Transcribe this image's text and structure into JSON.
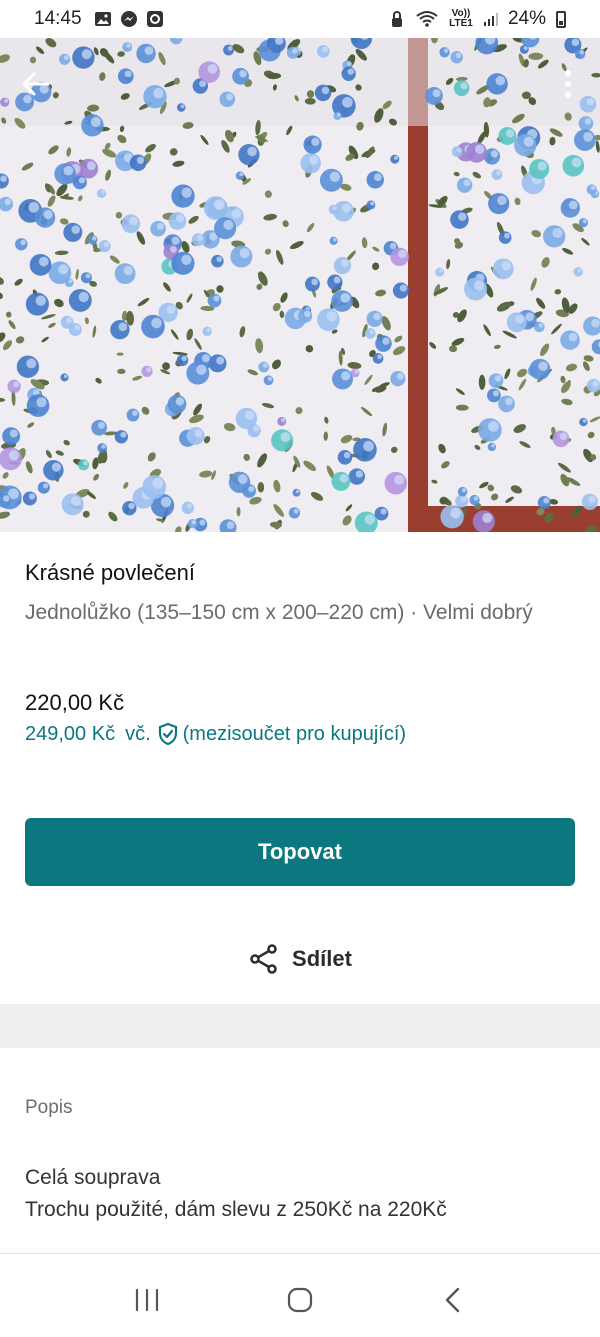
{
  "status_bar": {
    "time": "14:45",
    "network": "Vo)) LTE1",
    "battery": "24%",
    "icons": [
      "gallery-icon",
      "messenger-icon",
      "app-notification-icon",
      "lock-alarm-icon",
      "wifi-icon",
      "signal-icon",
      "battery-icon"
    ]
  },
  "hero": {
    "image_description_icon": "floral-bedding-photo",
    "back_icon": "arrow-left-icon",
    "menu_icon": "more-vertical-icon"
  },
  "listing": {
    "title": "Krásné povlečení",
    "subtitle": "Jednolůžko (135–150 cm x 200–220 cm) · Velmi dobrý",
    "price": "220,00 Kč",
    "buyer_price": "249,00 Kč",
    "buyer_price_suffix": "vč.",
    "buyer_protection_note": "(mezisoučet pro kupující)"
  },
  "actions": {
    "bump_label": "Topovat",
    "share_label": "Sdílet"
  },
  "description": {
    "label": "Popis",
    "text": "Celá souprava\nTrochu použité, dám slevu z 250Kč na 220Kč"
  },
  "colors": {
    "accent": "#0b7880",
    "text_primary": "#111111",
    "text_secondary": "#6b6b6b",
    "band": "#eef0f0",
    "brick": "#9a3f2f"
  },
  "system_nav": {
    "icons": [
      "recent-apps-icon",
      "home-icon",
      "back-icon"
    ]
  }
}
